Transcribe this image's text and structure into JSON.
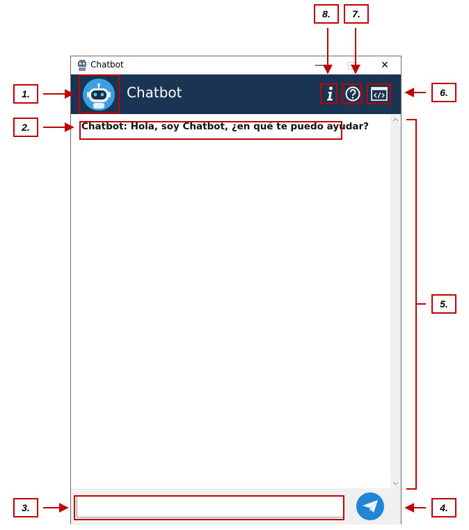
{
  "window": {
    "title": "Chatbot",
    "minimize": "—",
    "maximize": "□",
    "close": "✕"
  },
  "header": {
    "bot_name": "Chatbot",
    "info_icon": "info-icon",
    "help_icon": "help-circle-icon",
    "code_icon": "code-window-icon"
  },
  "chat": {
    "messages": [
      {
        "text": "Chatbot: Hola, soy Chatbot, ¿en qué te puedo ayudar?"
      }
    ]
  },
  "input": {
    "value": "",
    "placeholder": ""
  },
  "send_button": {
    "icon": "paper-plane-icon"
  },
  "annotations": {
    "l1": "1.",
    "l2": "2.",
    "l3": "3.",
    "l4": "4.",
    "l5": "5.",
    "l6": "6.",
    "l7": "7.",
    "l8": "8."
  },
  "colors": {
    "header_bg": "#1a3453",
    "annotation_red": "#c00000",
    "send_blue": "#1f86d8",
    "avatar_blue": "#3aa0e0"
  }
}
